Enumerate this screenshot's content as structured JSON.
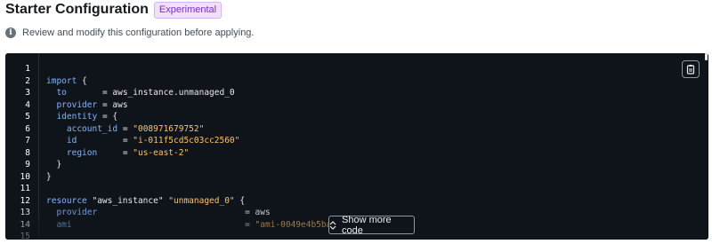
{
  "header": {
    "title": "Starter Configuration",
    "badge": "Experimental"
  },
  "info": {
    "text": "Review and modify this configuration before applying."
  },
  "code": {
    "lines": [
      {
        "n": "1",
        "tokens": []
      },
      {
        "n": "2",
        "tokens": [
          {
            "t": "import",
            "c": "kw"
          },
          {
            "t": " {",
            "c": "plain"
          }
        ]
      },
      {
        "n": "3",
        "tokens": [
          {
            "t": "  ",
            "c": "plain"
          },
          {
            "t": "to",
            "c": "kw"
          },
          {
            "t": "       = aws_instance.unmanaged_0",
            "c": "plain"
          }
        ]
      },
      {
        "n": "4",
        "tokens": [
          {
            "t": "  ",
            "c": "plain"
          },
          {
            "t": "provider",
            "c": "kw"
          },
          {
            "t": " = aws",
            "c": "plain"
          }
        ]
      },
      {
        "n": "5",
        "tokens": [
          {
            "t": "  ",
            "c": "plain"
          },
          {
            "t": "identity",
            "c": "kw"
          },
          {
            "t": " = {",
            "c": "plain"
          }
        ]
      },
      {
        "n": "6",
        "tokens": [
          {
            "t": "    ",
            "c": "plain"
          },
          {
            "t": "account_id",
            "c": "kw"
          },
          {
            "t": " = ",
            "c": "plain"
          },
          {
            "t": "\"008971679752\"",
            "c": "str"
          }
        ]
      },
      {
        "n": "7",
        "tokens": [
          {
            "t": "    ",
            "c": "plain"
          },
          {
            "t": "id",
            "c": "kw"
          },
          {
            "t": "         = ",
            "c": "plain"
          },
          {
            "t": "\"i-011f5cd5c03cc2560\"",
            "c": "str"
          }
        ]
      },
      {
        "n": "8",
        "tokens": [
          {
            "t": "    ",
            "c": "plain"
          },
          {
            "t": "region",
            "c": "kw"
          },
          {
            "t": "     = ",
            "c": "plain"
          },
          {
            "t": "\"us-east-2\"",
            "c": "str"
          }
        ]
      },
      {
        "n": "9",
        "tokens": [
          {
            "t": "  }",
            "c": "plain"
          }
        ]
      },
      {
        "n": "10",
        "tokens": [
          {
            "t": "}",
            "c": "plain"
          }
        ]
      },
      {
        "n": "11",
        "tokens": []
      },
      {
        "n": "12",
        "tokens": [
          {
            "t": "resource",
            "c": "kw"
          },
          {
            "t": " \"aws_instance\" ",
            "c": "plain"
          },
          {
            "t": "\"unmanaged_0\"",
            "c": "str"
          },
          {
            "t": " {",
            "c": "plain"
          }
        ]
      },
      {
        "n": "13",
        "tokens": [
          {
            "t": "  ",
            "c": "plain"
          },
          {
            "t": "provider",
            "c": "kw"
          },
          {
            "t": "                             = aws",
            "c": "plain"
          }
        ]
      },
      {
        "n": "14",
        "tokens": [
          {
            "t": "  ",
            "c": "plain"
          },
          {
            "t": "ami",
            "c": "kw"
          },
          {
            "t": "                                  = ",
            "c": "plain"
          },
          {
            "t": "\"ami-0049e4b5ba14b6d3e\"",
            "c": "str"
          }
        ]
      },
      {
        "n": "15",
        "tokens": []
      }
    ]
  },
  "show_more": {
    "label": "Show more code"
  },
  "colors": {
    "background": "#0f141a",
    "keyword": "#82b4ff",
    "string": "#ffc266",
    "badge_text": "#7d2ccf",
    "badge_bg": "#f0e0fc"
  },
  "icons": {
    "info": "info-circle-icon",
    "copy": "copy-icon",
    "expand": "expand-vertical-icon"
  }
}
